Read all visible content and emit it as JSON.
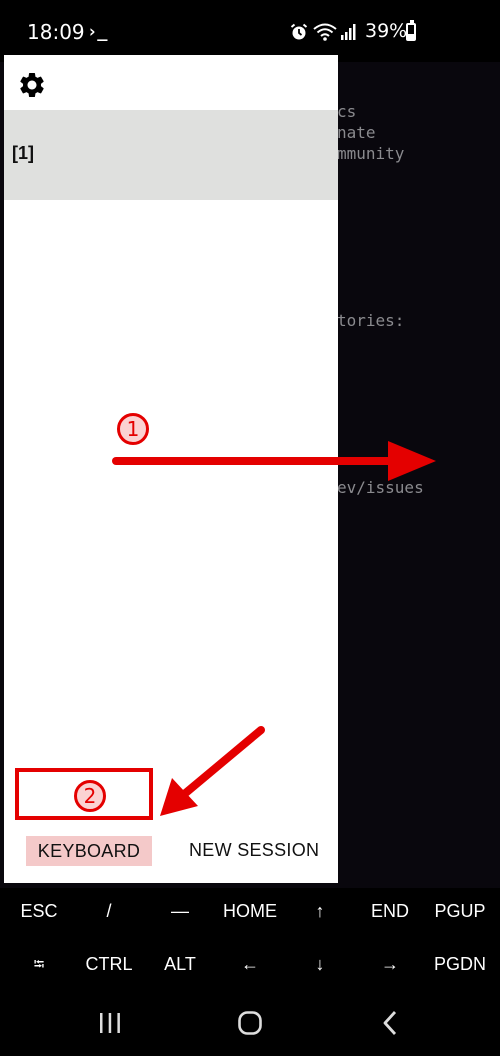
{
  "status_bar": {
    "time": "18:09",
    "prompt_glyph": "›_",
    "battery": "39%",
    "battery_level": 0.39,
    "icons": [
      "alarm-icon",
      "wifi-icon",
      "signal-icon",
      "battery-icon"
    ]
  },
  "terminal": {
    "lines": [
      "cs",
      "nate",
      "mmunity",
      "tories:",
      "ev/issues"
    ]
  },
  "drawer": {
    "sessions": [
      {
        "label": "[1]"
      }
    ],
    "keyboard_label": "KEYBOARD",
    "new_session_label": "NEW SESSION"
  },
  "extra_keys": {
    "row1": [
      "ESC",
      "/",
      "—",
      "HOME",
      "↑",
      "END",
      "PGUP"
    ],
    "row2": [
      "⭾",
      "CTRL",
      "ALT",
      "←",
      "↓",
      "→",
      "PGDN"
    ]
  },
  "annotations": {
    "step1": "1",
    "step2": "2",
    "accent": "#e40000"
  },
  "nav_bar": {
    "icons": [
      "recent-apps-icon",
      "home-icon",
      "back-icon"
    ]
  }
}
